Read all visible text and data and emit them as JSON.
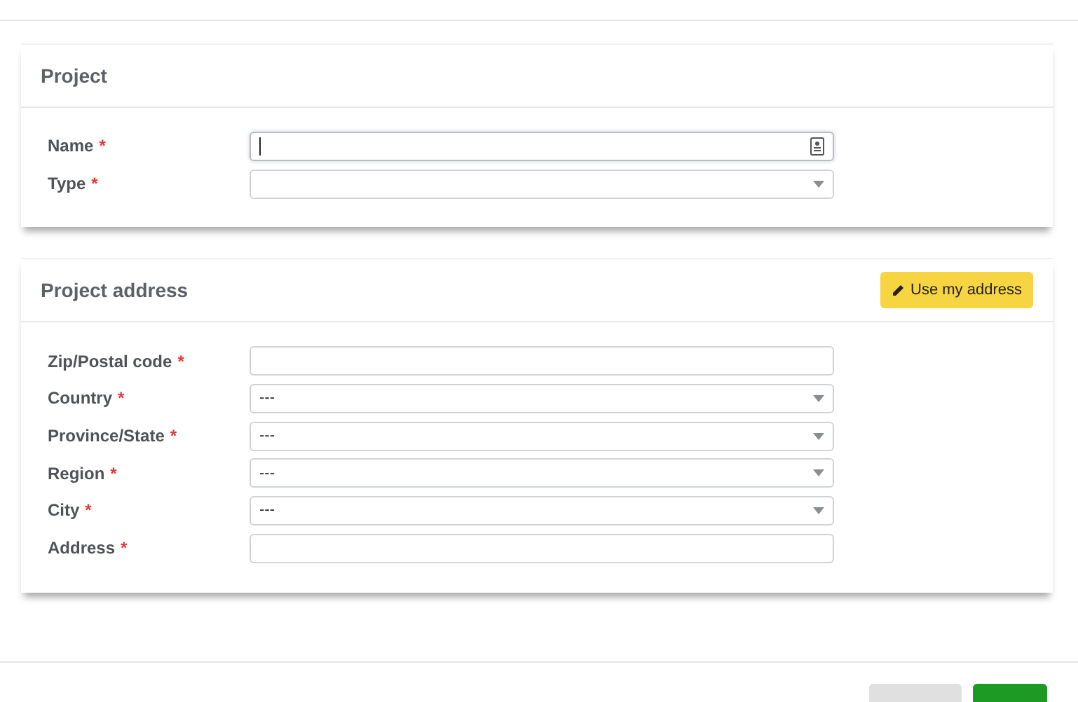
{
  "sections": [
    {
      "title": "Project",
      "fields": [
        {
          "label": "Name",
          "required_mark": "*",
          "kind": "text",
          "focused": true
        },
        {
          "label": "Type",
          "required_mark": "*",
          "kind": "select"
        }
      ]
    },
    {
      "title": "Project address",
      "action": "Use my address",
      "fields": [
        {
          "label": "Zip/Postal code",
          "required_mark": "*",
          "kind": "text"
        },
        {
          "label": "Country",
          "required_mark": "*",
          "kind": "select",
          "value": "---"
        },
        {
          "label": "Province/State",
          "required_mark": "*",
          "kind": "select",
          "value": "---"
        },
        {
          "label": "Region",
          "required_mark": "*",
          "kind": "select",
          "value": "---"
        },
        {
          "label": "City",
          "required_mark": "*",
          "kind": "select",
          "value": "---"
        },
        {
          "label": "Address",
          "required_mark": "*",
          "kind": "text"
        }
      ]
    }
  ],
  "footer": {
    "buttons": [
      {
        "kind": "secondary"
      },
      {
        "kind": "primary"
      }
    ]
  }
}
